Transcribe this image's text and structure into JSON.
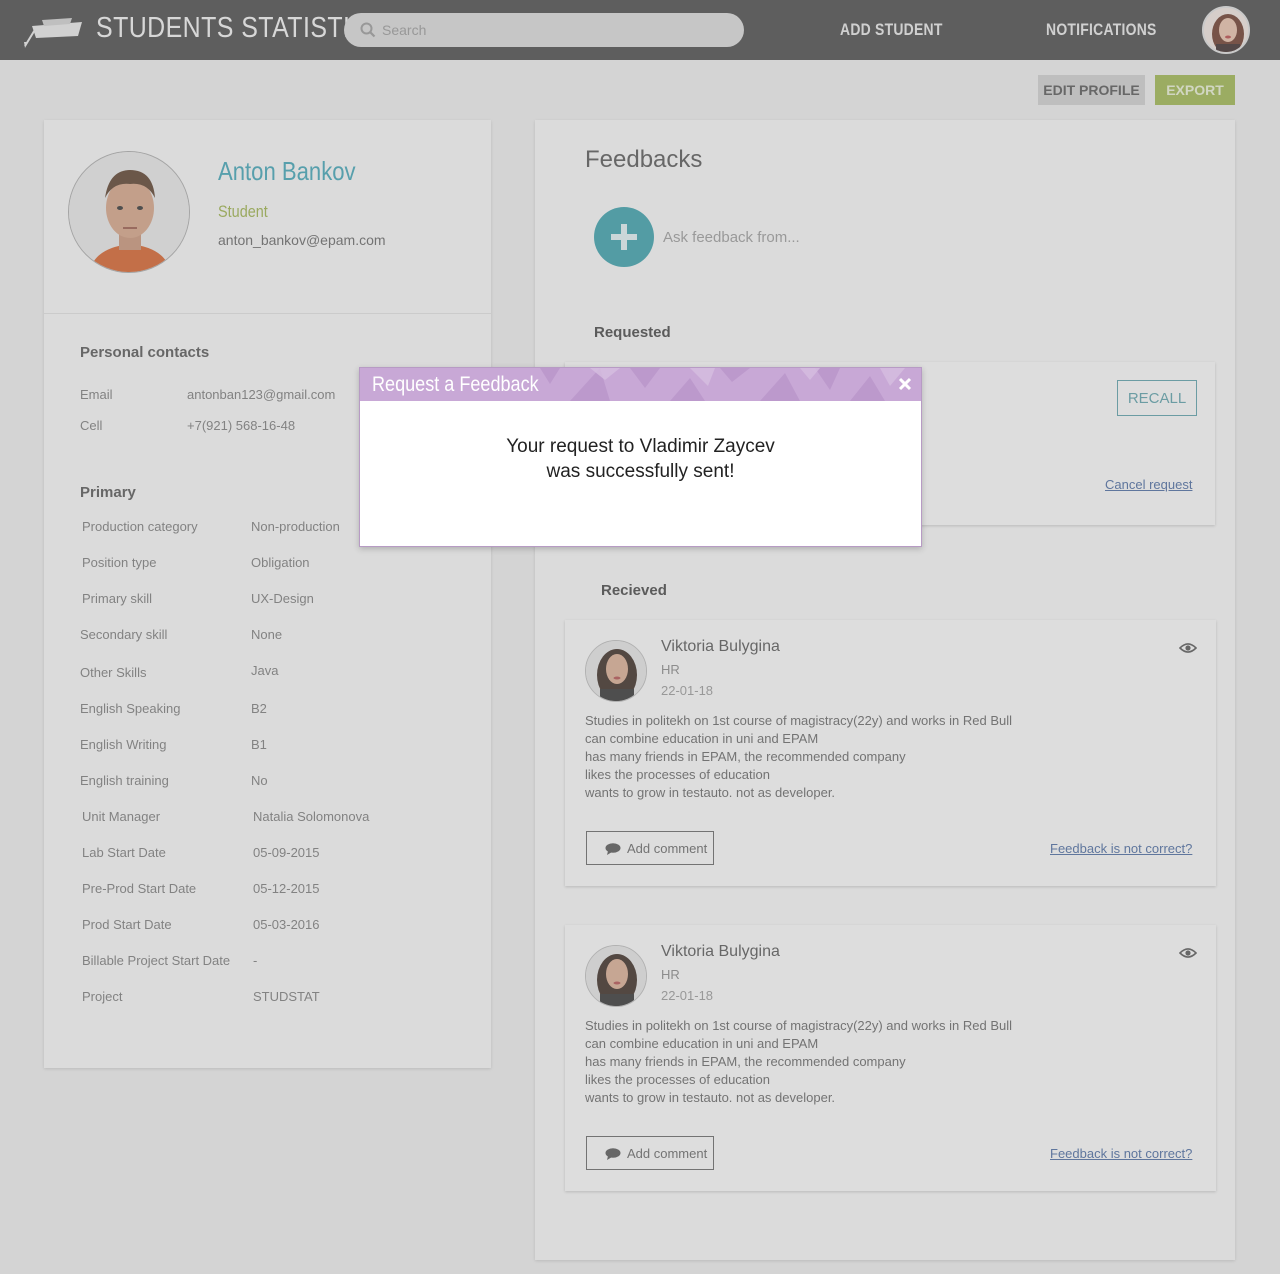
{
  "header": {
    "app_title": "STUDENTS STATISTICS",
    "search_placeholder": "Search",
    "nav": [
      "ADD STUDENT",
      "NOTIFICATIONS"
    ]
  },
  "actions": {
    "edit_profile": "EDIT PROFILE",
    "export": "EXPORT"
  },
  "profile": {
    "name": "Anton Bankov",
    "role": "Student",
    "email": "anton_bankov@epam.com"
  },
  "personal_contacts": {
    "title": "Personal contacts",
    "rows": [
      {
        "label": "Email",
        "value": "antonban123@gmail.com"
      },
      {
        "label": "Cell",
        "value": "+7(921) 568-16-48"
      }
    ]
  },
  "primary": {
    "title": "Primary",
    "rows": [
      {
        "label": "Production category",
        "value": "Non-production"
      },
      {
        "label": "Position type",
        "value": "Obligation"
      },
      {
        "label": "Primary skill",
        "value": "UX-Design"
      },
      {
        "label": "Secondary skill",
        "value": "None"
      },
      {
        "label": "Other Skills",
        "value": "Java"
      },
      {
        "label": "English Speaking",
        "value": "B2"
      },
      {
        "label": "English Writing",
        "value": "B1"
      },
      {
        "label": "English training",
        "value": "No"
      },
      {
        "label": "Unit Manager",
        "value": "Natalia Solomonova"
      },
      {
        "label": "Lab Start Date",
        "value": "05-09-2015"
      },
      {
        "label": "Pre-Prod Start Date",
        "value": "05-12-2015"
      },
      {
        "label": "Prod Start Date",
        "value": "05-03-2016"
      },
      {
        "label": "Billable Project Start Date",
        "value": "-"
      },
      {
        "label": "Project",
        "value": "STUDSTAT"
      }
    ]
  },
  "feedbacks": {
    "title": "Feedbacks",
    "ask_placeholder": "Ask feedback from...",
    "requested_title": "Requested",
    "recall": "RECALL",
    "cancel_request": "Cancel request",
    "received_title": "Recieved",
    "items": [
      {
        "name": "Viktoria Bulygina",
        "role": "HR",
        "date": "22-01-18",
        "lines": [
          "Studies in politekh on 1st course of magistracy(22y) and works in Red Bull",
          "can combine education in uni and EPAM",
          "has many friends in EPAM, the recommended company",
          "likes the processes of education",
          "wants to grow in testauto. not as developer."
        ],
        "add_comment": "Add comment",
        "not_correct": "Feedback is not correct?"
      },
      {
        "name": "Viktoria Bulygina",
        "role": "HR",
        "date": "22-01-18",
        "lines": [
          "Studies in politekh on 1st course of magistracy(22y) and works in Red Bull",
          "can combine education in uni and EPAM",
          "has many friends in EPAM, the recommended company",
          "likes the processes of education",
          "wants to grow in testauto. not as developer."
        ],
        "add_comment": "Add comment",
        "not_correct": "Feedback is not correct?"
      }
    ]
  },
  "modal": {
    "title": "Request a Feedback",
    "message_line1": "Your request to Vladimir Zaycev",
    "message_line2": "was successfully sent!"
  },
  "colors": {
    "topbar": "#484848",
    "accent_teal": "#3fa3b5",
    "accent_green": "#9db54e",
    "modal_header": "#c8a8d6"
  }
}
